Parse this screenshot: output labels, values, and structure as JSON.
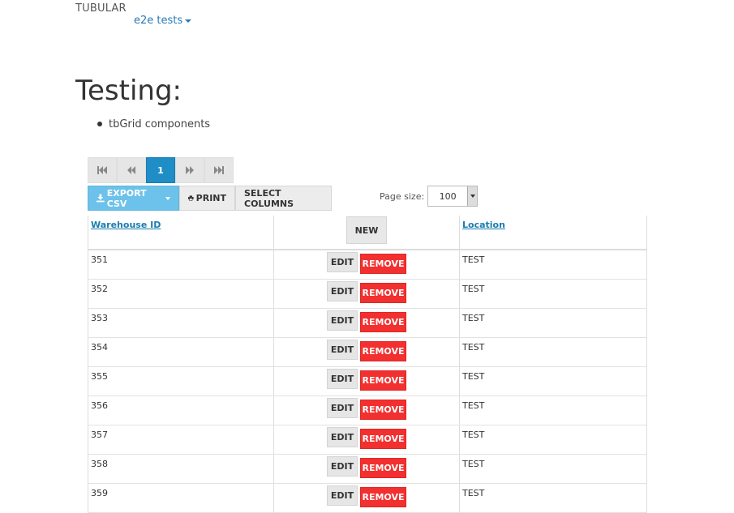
{
  "header": {
    "brand": "TUBULAR",
    "nav_link": "e2e tests"
  },
  "page": {
    "title": "Testing:",
    "bullets": [
      "tbGrid components"
    ]
  },
  "pager": {
    "current_page": "1",
    "buttons": [
      "first-page-icon",
      "previous-page-icon",
      "next-page-icon",
      "last-page-icon"
    ]
  },
  "toolbar": {
    "export_label": "EXPORT CSV",
    "print_label": "PRINT",
    "select_columns_label": "SELECT COLUMNS",
    "page_size_label": "Page size:",
    "page_size_value": "100"
  },
  "grid": {
    "columns": [
      "Warehouse ID",
      "Location"
    ],
    "new_label": "NEW",
    "edit_label": "EDIT",
    "remove_label": "REMOVE",
    "rows": [
      {
        "id": "351",
        "location": "TEST"
      },
      {
        "id": "352",
        "location": "TEST"
      },
      {
        "id": "353",
        "location": "TEST"
      },
      {
        "id": "354",
        "location": "TEST"
      },
      {
        "id": "355",
        "location": "TEST"
      },
      {
        "id": "356",
        "location": "TEST"
      },
      {
        "id": "357",
        "location": "TEST"
      },
      {
        "id": "358",
        "location": "TEST"
      },
      {
        "id": "359",
        "location": "TEST"
      }
    ]
  },
  "colors": {
    "accent": "#1f8dc6",
    "export": "#6cc2ea",
    "remove": "#f2302f",
    "link": "#2a7ab8"
  }
}
